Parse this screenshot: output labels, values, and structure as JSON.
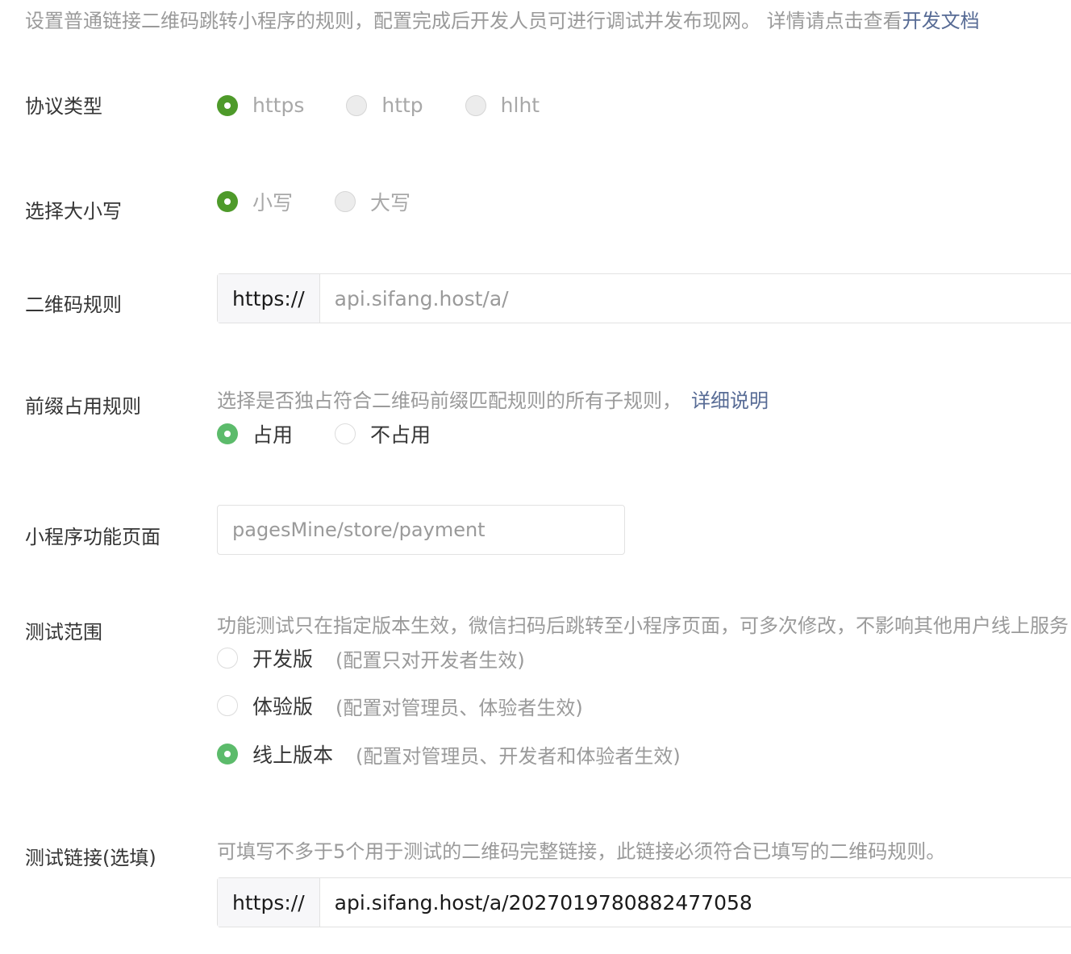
{
  "intro": {
    "text": "设置普通链接二维码跳转小程序的规则，配置完成后开发人员可进行调试并发布现网。 详情请点击查看",
    "link": "开发文档"
  },
  "protocol": {
    "label": "协议类型",
    "options": [
      "https",
      "http",
      "hlht"
    ],
    "selected": "https"
  },
  "case": {
    "label": "选择大小写",
    "options": [
      "小写",
      "大写"
    ],
    "selected": "小写"
  },
  "qr_rule": {
    "label": "二维码规则",
    "prefix": "https://",
    "value": "api.sifang.host/a/"
  },
  "prefix_rule": {
    "label": "前缀占用规则",
    "help": "选择是否独占符合二维码前缀匹配规则的所有子规则，",
    "help_link": "详细说明",
    "options": [
      "占用",
      "不占用"
    ],
    "selected": "占用"
  },
  "page": {
    "label": "小程序功能页面",
    "value": "pagesMine/store/payment"
  },
  "test_scope": {
    "label": "测试范围",
    "help": "功能测试只在指定版本生效，微信扫码后跳转至小程序页面，可多次修改，不影响其他用户线上服务",
    "options": [
      {
        "label": "开发版",
        "note": "(配置只对开发者生效)"
      },
      {
        "label": "体验版",
        "note": "(配置对管理员、体验者生效)"
      },
      {
        "label": "线上版本",
        "note": "(配置对管理员、开发者和体验者生效)"
      }
    ],
    "selected": "线上版本"
  },
  "test_link": {
    "label": "测试链接(选填)",
    "help": "可填写不多于5个用于测试的二维码完整链接，此链接必须符合已填写的二维码规则。",
    "prefix": "https://",
    "value": "api.sifang.host/a/2027019780882477058"
  }
}
